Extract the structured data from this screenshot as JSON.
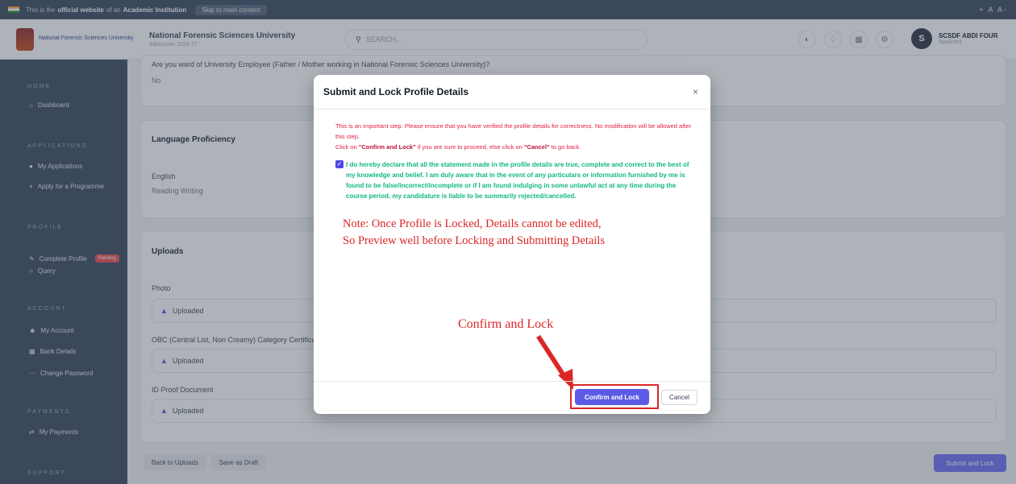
{
  "gov_bar": {
    "prefix": "This is the",
    "highlight": "official website",
    "mid": "of an",
    "highlight2": "Academic Institution",
    "skip": "Skip to main content",
    "a11y": "+ A A-"
  },
  "header": {
    "logo_text": "National Forensic Sciences University",
    "university": "National Forensic Sciences University",
    "subtitle": "Admission 2026-27",
    "search_placeholder": "SEARCH...",
    "user_initial": "S",
    "user_name": "SCSDF ABDI FOUR",
    "user_role": "Applicant"
  },
  "sidebar": {
    "home": "HOME",
    "dashboard": "Dashboard",
    "applications": "APPLICATIONS",
    "my_applications": "My Applications",
    "apply": "Apply for a Programme",
    "profile": "PROFILE",
    "complete_profile": "Complete Profile",
    "pending_badge": "Pending",
    "query": "Query",
    "account": "ACCOUNT",
    "my_account": "My Account",
    "bank_details": "Bank Details",
    "change_password": "Change Password",
    "payments": "PAYMENTS",
    "my_payments": "My Payments",
    "support": "SUPPORT"
  },
  "main": {
    "ward_question": "Are you ward of University Employee (Father / Mother working in National Forensic Sciences University)?",
    "ward_answer": "No",
    "language_title": "Language Proficiency",
    "language": "English",
    "language_skills": "Reading Writing",
    "uploads_title": "Uploads",
    "photo_label": "Photo",
    "uploaded": "Uploaded",
    "obc_label": "OBC (Central List, Non Creamy) Category Certificate",
    "id_label": "ID Proof Document",
    "back_button": "Back to Uploads",
    "draft_button": "Save as Draft",
    "submit_button": "Submit and Lock"
  },
  "modal": {
    "title": "Submit and Lock Profile Details",
    "close": "×",
    "warning_1": "This is an important step. Please ensure that you have verified the profile details for correctness. No modification will be allowed after this step.",
    "warning_2a": "Click on ",
    "warning_2b": "\"Confirm and Lock\"",
    "warning_2c": " if you are sure to proceed, else click on ",
    "warning_2d": "\"Cancel\"",
    "warning_2e": " to go back.",
    "declaration": "I do hereby declare that all the statement made in the profile details are true, complete and correct to the best of my knowledge and belief. I am duly aware that in the event of any particulars or information furnished by me is found to be false/incorrect/incomplete or if I am found indulging in some unlawful act at any time during the course period, my candidature is liable to be summarily rejected/cancelled.",
    "checked": true,
    "note_line1": "Note: Once Profile is Locked, Details cannot be edited,",
    "note_line2": "So Preview well before Locking and Submitting Details",
    "annotation": "Confirm and Lock",
    "confirm_button": "Confirm and Lock",
    "cancel_button": "Cancel"
  },
  "colors": {
    "sidebar": "#2f3e56",
    "primary": "#5b5be6",
    "warning": "#e11d48",
    "declaration": "#10b981",
    "annotation": "#dc2626"
  }
}
